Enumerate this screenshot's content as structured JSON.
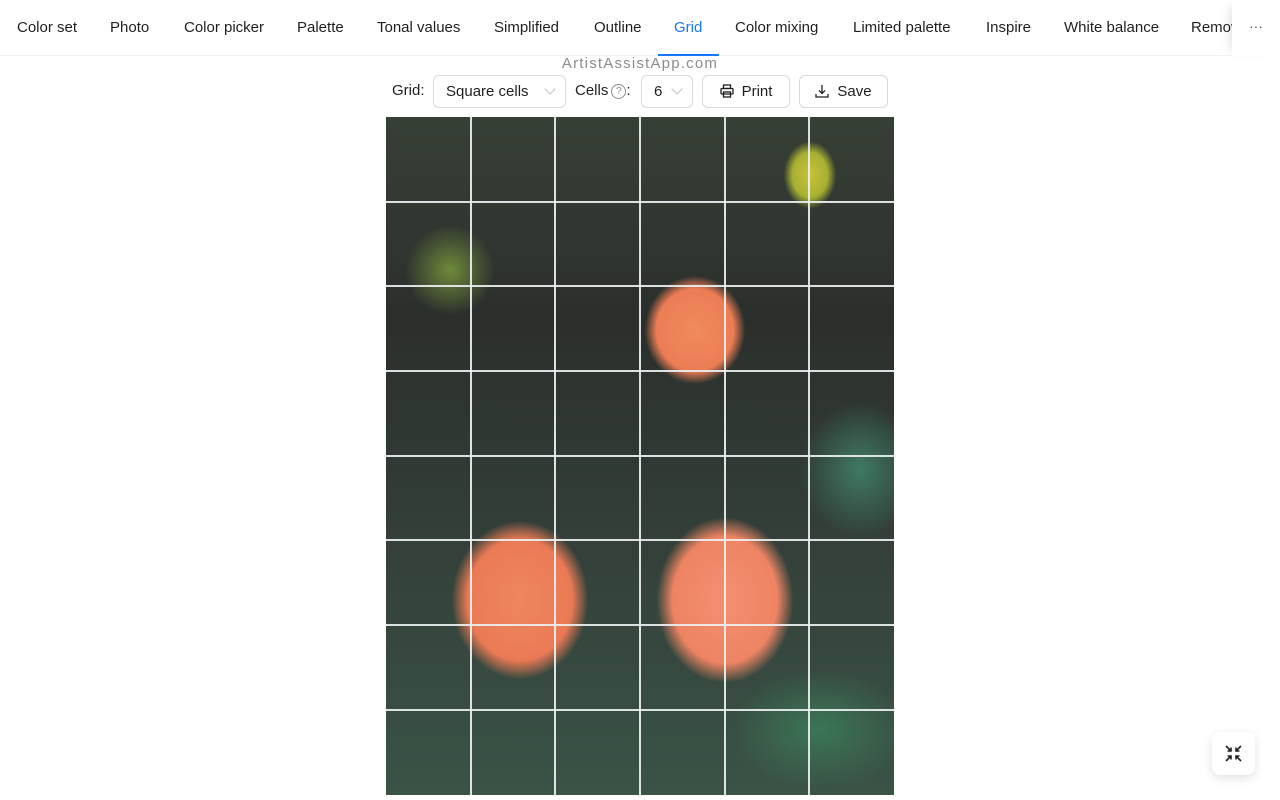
{
  "tabs": {
    "items": [
      {
        "label": "Color set"
      },
      {
        "label": "Photo"
      },
      {
        "label": "Color picker"
      },
      {
        "label": "Palette"
      },
      {
        "label": "Tonal values"
      },
      {
        "label": "Simplified"
      },
      {
        "label": "Outline"
      },
      {
        "label": "Grid"
      },
      {
        "label": "Color mixing"
      },
      {
        "label": "Limited palette"
      },
      {
        "label": "Inspire"
      },
      {
        "label": "White balance"
      },
      {
        "label": "Remove background"
      }
    ],
    "active": "Grid",
    "more_label": "···",
    "accent_color": "#1677ff"
  },
  "watermark": "ArtistAssistApp.com",
  "toolbar": {
    "grid_label": "Grid",
    "grid_value": "Square cells",
    "cells_label": "Cells",
    "help_icon": "?",
    "cells_value": "6",
    "print_label": "Print",
    "save_label": "Save"
  },
  "grid": {
    "type": "square",
    "columns": 6,
    "rows": 8
  },
  "photo": {
    "subject": "Orange dahlia flowers with green foliage"
  },
  "fullscreen": {
    "icon": "fullscreen-exit-icon"
  }
}
